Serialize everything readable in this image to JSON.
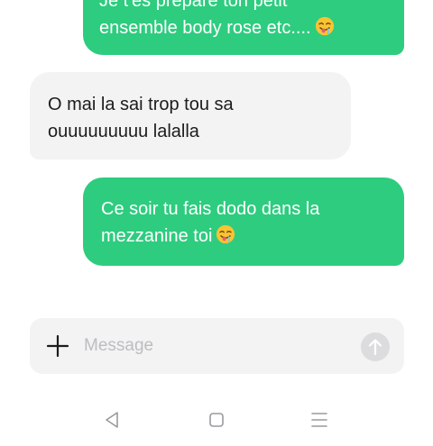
{
  "conversation": {
    "messages": [
      {
        "direction": "sent",
        "text": "Je t'es préparé ton petit\nensemble body rose etc....",
        "emoji": "drooling-face"
      },
      {
        "direction": "received",
        "text": "O mai la sai trop tou sa\nouuuuuuuuu lalalla"
      },
      {
        "direction": "sent",
        "text": "Ce soir tu fais dodo dans la\nmezzanine toi",
        "emoji": "drooling-face"
      }
    ]
  },
  "composer": {
    "placeholder": "Message",
    "value": "",
    "attach_icon": "plus-icon",
    "send_icon": "arrow-up-icon"
  },
  "nav_bar": {
    "buttons": [
      "back-triangle-icon",
      "home-square-icon",
      "menu-lines-icon"
    ]
  },
  "colors": {
    "sent_bubble": "#2ecc7f",
    "received_bubble": "#f3f3f4",
    "composer_background": "#f3f3f4",
    "send_button_disabled": "#dcdcde"
  }
}
